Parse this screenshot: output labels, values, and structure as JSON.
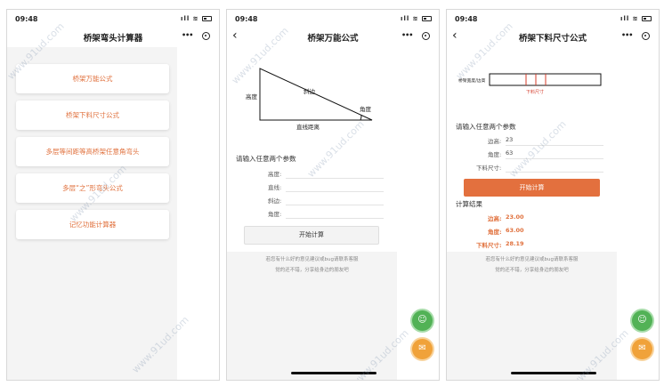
{
  "status_bar": {
    "time": "09:48",
    "signal": "ıll ≋"
  },
  "screen1": {
    "title": "桥架弯头计算器",
    "menu": [
      "桥架万能公式",
      "桥架下料尺寸公式",
      "多层等间距等高桥架任意角弯头",
      "多层“之”形弯头公式",
      "记忆功能计算器"
    ]
  },
  "screen2": {
    "title": "桥架万能公式",
    "diagram": {
      "height_label": "高度",
      "hyp_label": "斜边",
      "angle_label": "角度",
      "base_label": "直线距离"
    },
    "section_title": "请输入任意两个参数",
    "fields": [
      {
        "label": "高度:",
        "value": ""
      },
      {
        "label": "直线:",
        "value": ""
      },
      {
        "label": "斜边:",
        "value": ""
      },
      {
        "label": "角度:",
        "value": ""
      }
    ],
    "calc_button": "开始计算",
    "footer": [
      "若您有什么好的意见建议或bug请联系客服",
      "觉的还不错，分享给身边的朋友吧"
    ]
  },
  "screen3": {
    "title": "桥架下料尺寸公式",
    "diagram": {
      "left_label": "桥架宽度/边高",
      "bottom_label": "下料尺寸"
    },
    "section_title": "请输入任意两个参数",
    "fields": [
      {
        "label": "边高:",
        "value": "23"
      },
      {
        "label": "角度:",
        "value": "63"
      },
      {
        "label": "下料尺寸:",
        "value": ""
      }
    ],
    "calc_button": "开始计算",
    "results_title": "计算结果",
    "results": [
      {
        "label": "边高:",
        "value": "23.00"
      },
      {
        "label": "角度:",
        "value": "63.00"
      },
      {
        "label": "下料尺寸:",
        "value": "28.19"
      }
    ],
    "footer": [
      "若您有什么好的意见建议或bug请联系客服",
      "觉的还不错，分享给身边的朋友吧"
    ]
  },
  "watermark_text": "www.91ud.com",
  "colors": {
    "accent": "#e3703e",
    "green_fab": "#52b256",
    "orange_fab": "#f0a23a"
  }
}
